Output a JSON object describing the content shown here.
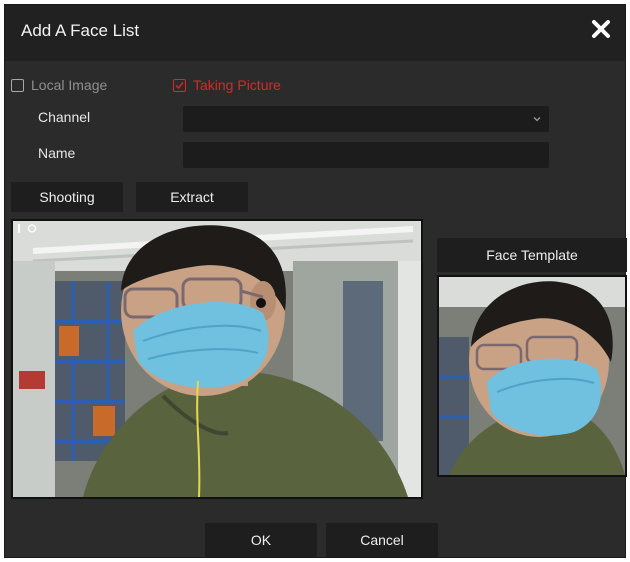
{
  "dialog": {
    "title": "Add A Face List",
    "close_icon": "close-icon"
  },
  "source_options": {
    "local_image": {
      "label": "Local Image",
      "checked": false
    },
    "taking_picture": {
      "label": "Taking Picture",
      "checked": true
    }
  },
  "form": {
    "channel": {
      "label": "Channel",
      "value": ""
    },
    "name": {
      "label": "Name",
      "value": ""
    }
  },
  "buttons": {
    "shooting": "Shooting",
    "extract": "Extract",
    "ok": "OK",
    "cancel": "Cancel"
  },
  "panels": {
    "face_template": "Face Template"
  },
  "colors": {
    "dialog_bg": "#2b2b2b",
    "titlebar_bg": "#212121",
    "button_bg": "#1e1e1e",
    "input_bg": "#1c1c1c",
    "accent_red": "#d22b2b"
  }
}
